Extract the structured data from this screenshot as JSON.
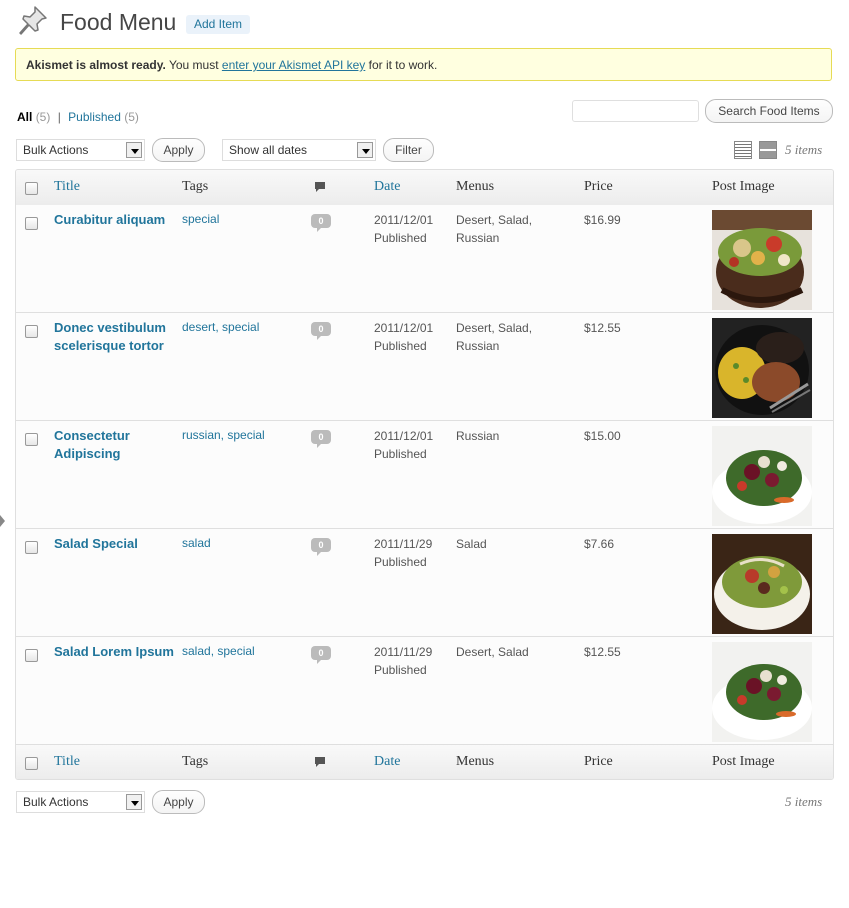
{
  "header": {
    "title": "Food Menu",
    "add_item": "Add Item"
  },
  "notice": {
    "bold": "Akismet is almost ready.",
    "before_link": " You must ",
    "link": "enter your Akismet API key",
    "after_link": " for it to work."
  },
  "views": {
    "all_label": "All",
    "all_count": "(5)",
    "separator": "|",
    "published_label": "Published",
    "published_count": "(5)"
  },
  "search": {
    "value": "",
    "button": "Search Food Items"
  },
  "toolbar_top": {
    "bulk_actions": "Bulk Actions",
    "apply": "Apply",
    "dates": "Show all dates",
    "filter": "Filter",
    "items_count": "5 items"
  },
  "toolbar_bottom": {
    "bulk_actions": "Bulk Actions",
    "apply": "Apply",
    "items_count": "5 items"
  },
  "columns": {
    "title": "Title",
    "tags": "Tags",
    "date": "Date",
    "menus": "Menus",
    "price": "Price",
    "image": "Post Image"
  },
  "rows": [
    {
      "title": "Curabitur aliquam",
      "tags": "special",
      "comments": "0",
      "date": "2011/12/01",
      "status": "Published",
      "menus": "Desert, Salad, Russian",
      "price": "$16.99",
      "image": "mixed-salad-bowl"
    },
    {
      "title": "Donec vestibulum scelerisque tortor",
      "tags": "desert, special",
      "comments": "0",
      "date": "2011/12/01",
      "status": "Published",
      "menus": "Desert, Salad, Russian",
      "price": "$12.55",
      "image": "rice-beans-meat-plate"
    },
    {
      "title": "Consectetur Adipiscing",
      "tags": "russian, special",
      "comments": "0",
      "date": "2011/12/01",
      "status": "Published",
      "menus": "Russian",
      "price": "$15.00",
      "image": "beet-salad"
    },
    {
      "title": "Salad Special",
      "tags": "salad",
      "comments": "0",
      "date": "2011/11/29",
      "status": "Published",
      "menus": "Salad",
      "price": "$7.66",
      "image": "green-salad-bowl"
    },
    {
      "title": "Salad Lorem Ipsum",
      "tags": "salad, special",
      "comments": "0",
      "date": "2011/11/29",
      "status": "Published",
      "menus": "Desert, Salad",
      "price": "$12.55",
      "image": "beet-salad"
    }
  ],
  "colors": {
    "link": "#21759b",
    "notice_bg": "#ffffe0",
    "notice_border": "#e6db55"
  }
}
